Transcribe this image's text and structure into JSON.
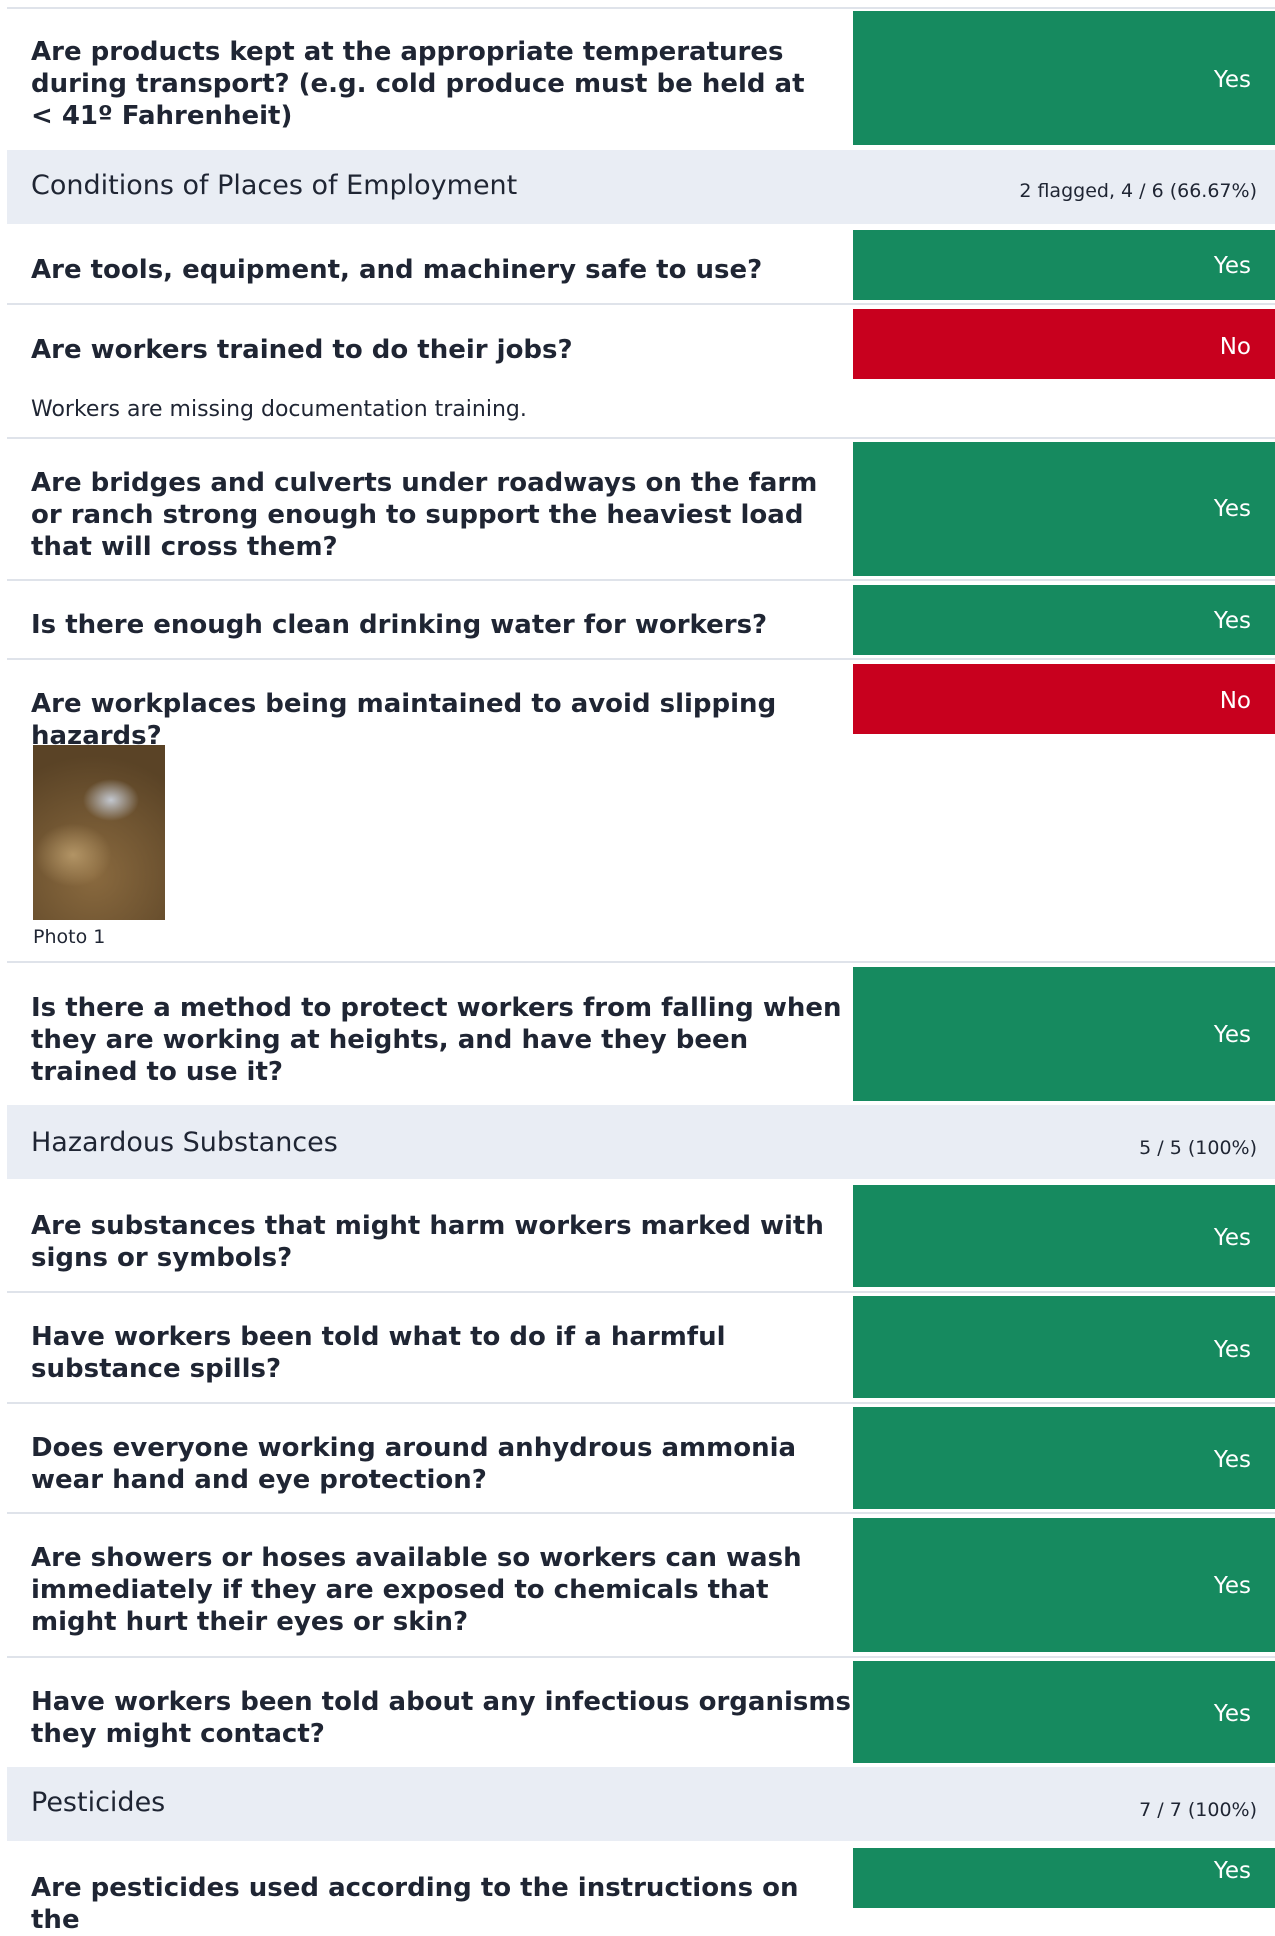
{
  "items": [
    {
      "id": "q-transport-temp",
      "question": "Are products kept at the appropriate temperatures during transport? (e.g. cold produce must be held at < 41º Fahrenheit)",
      "answer": "Yes"
    },
    {
      "id": "q-tools-safe",
      "question": "Are tools, equipment, and machinery safe to use?",
      "answer": "Yes"
    },
    {
      "id": "q-workers-trained",
      "question": "Are workers trained to do their jobs?",
      "answer": "No",
      "note": "Workers are missing documentation training."
    },
    {
      "id": "q-bridges",
      "question": "Are bridges and culverts under roadways on the farm or ranch strong enough to support the heaviest load that will cross them?",
      "answer": "Yes"
    },
    {
      "id": "q-drinking-water",
      "question": "Is there enough clean drinking water for workers?",
      "answer": "Yes"
    },
    {
      "id": "q-slipping",
      "question": "Are workplaces being maintained to avoid slipping hazards?",
      "answer": "No",
      "photo_caption": "Photo 1"
    },
    {
      "id": "q-fall-protection",
      "question": "Is there a method to protect workers from falling when they are working at heights, and have they been trained to use it?",
      "answer": "Yes"
    },
    {
      "id": "q-substances-marked",
      "question": "Are substances that might harm workers marked with signs or symbols?",
      "answer": "Yes"
    },
    {
      "id": "q-spills",
      "question": "Have workers been told what to do if a harmful substance spills?",
      "answer": "Yes"
    },
    {
      "id": "q-ammonia",
      "question": "Does everyone working around anhydrous ammonia wear hand and eye protection?",
      "answer": "Yes"
    },
    {
      "id": "q-showers",
      "question": "Are showers or hoses available so workers can wash immediately if they are exposed to chemicals that might hurt their eyes or skin?",
      "answer": "Yes"
    },
    {
      "id": "q-infectious",
      "question": "Have workers been told about any infectious organisms they might contact?",
      "answer": "Yes"
    },
    {
      "id": "q-pesticides-instructions",
      "question": "Are pesticides used according to the instructions on the",
      "answer": "Yes"
    }
  ],
  "sections": [
    {
      "title": "Conditions of Places of Employment",
      "score": "2 flagged, 4 / 6 (66.67%)"
    },
    {
      "title": "Hazardous Substances",
      "score": "5 / 5 (100%)"
    },
    {
      "title": "Pesticides",
      "score": "7 / 7 (100%)"
    }
  ],
  "colors": {
    "yes": "#168a5f",
    "no": "#c8001e",
    "section_bg": "#e9edf4",
    "separator": "#dfe3ea"
  }
}
